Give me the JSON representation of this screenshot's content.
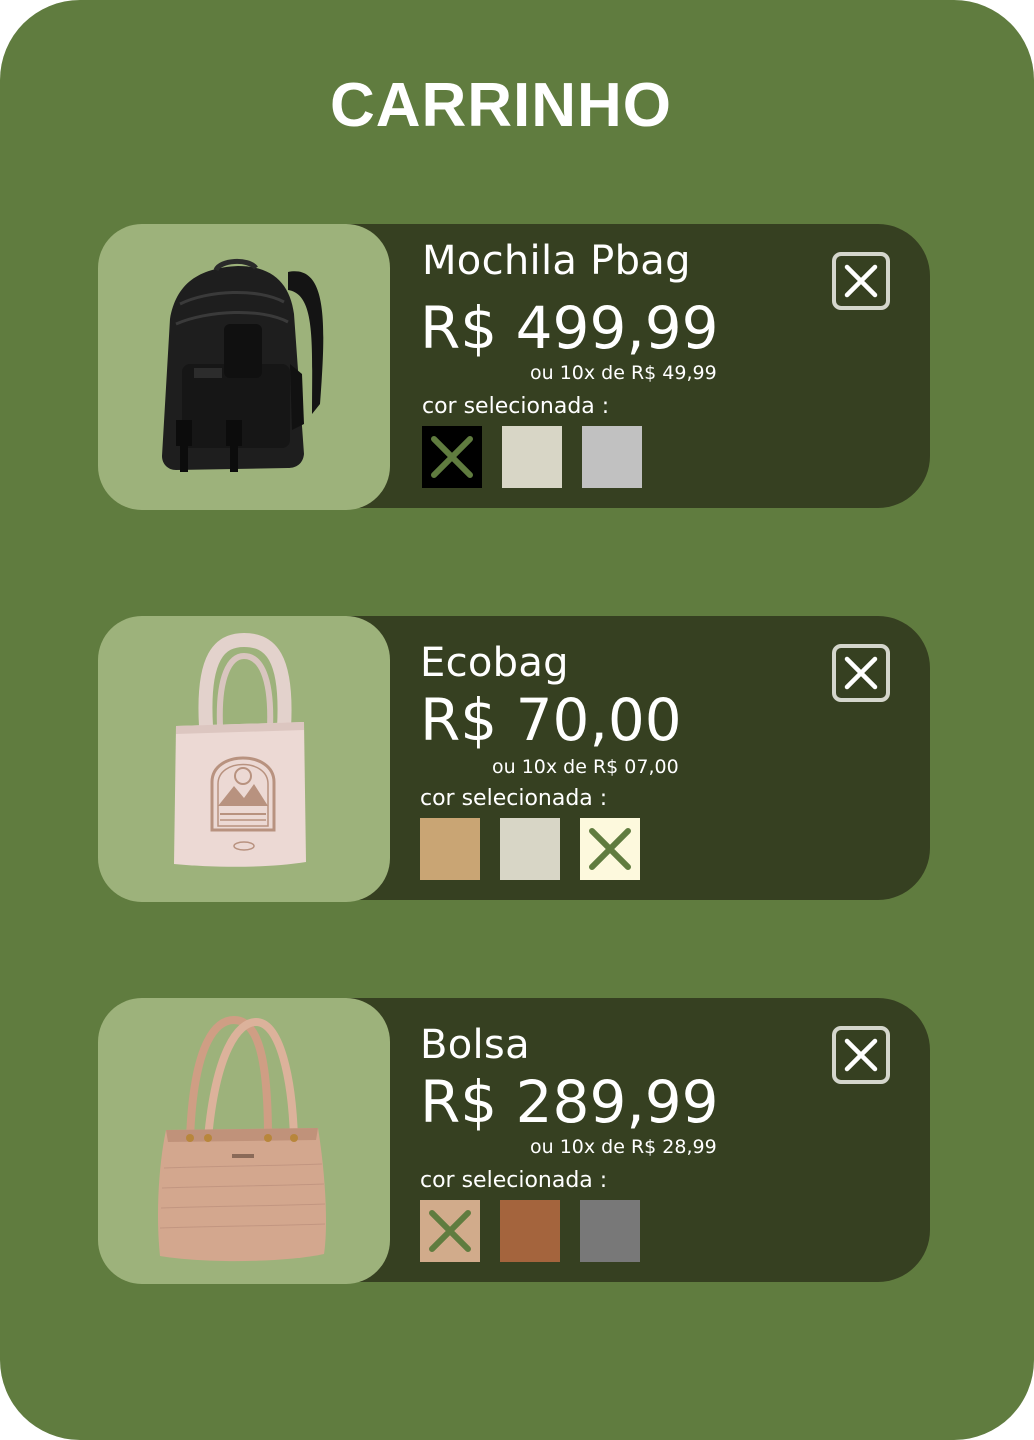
{
  "cart": {
    "title": "CARRINHO",
    "items": [
      {
        "name": "Mochila Pbag",
        "price": "R$ 499,99",
        "installments": "ou 10x de R$ 49,99",
        "color_label": "cor selecionada :",
        "image_icon": "backpack-image",
        "colors": [
          {
            "hex": "#000000",
            "selected": true
          },
          {
            "hex": "#d8d6c6",
            "selected": false
          },
          {
            "hex": "#c1c1c1",
            "selected": false
          }
        ]
      },
      {
        "name": "Ecobag",
        "price": "R$ 70,00",
        "installments": "ou 10x de R$ 07,00",
        "color_label": "cor selecionada :",
        "image_icon": "tote-bag-image",
        "colors": [
          {
            "hex": "#c9a574",
            "selected": false
          },
          {
            "hex": "#d8d6c6",
            "selected": false
          },
          {
            "hex": "#fdf9dd",
            "selected": true
          }
        ]
      },
      {
        "name": "Bolsa",
        "price": "R$ 289,99",
        "installments": "ou 10x de R$ 28,99",
        "color_label": "cor selecionada :",
        "image_icon": "handbag-image",
        "colors": [
          {
            "hex": "#d1ab8b",
            "selected": true
          },
          {
            "hex": "#a4643d",
            "selected": false
          },
          {
            "hex": "#787878",
            "selected": false
          }
        ]
      }
    ]
  },
  "theme": {
    "background": "#607c3f",
    "card": "#364021",
    "thumb": "#9db27b",
    "check_mark": "#607c3f"
  }
}
